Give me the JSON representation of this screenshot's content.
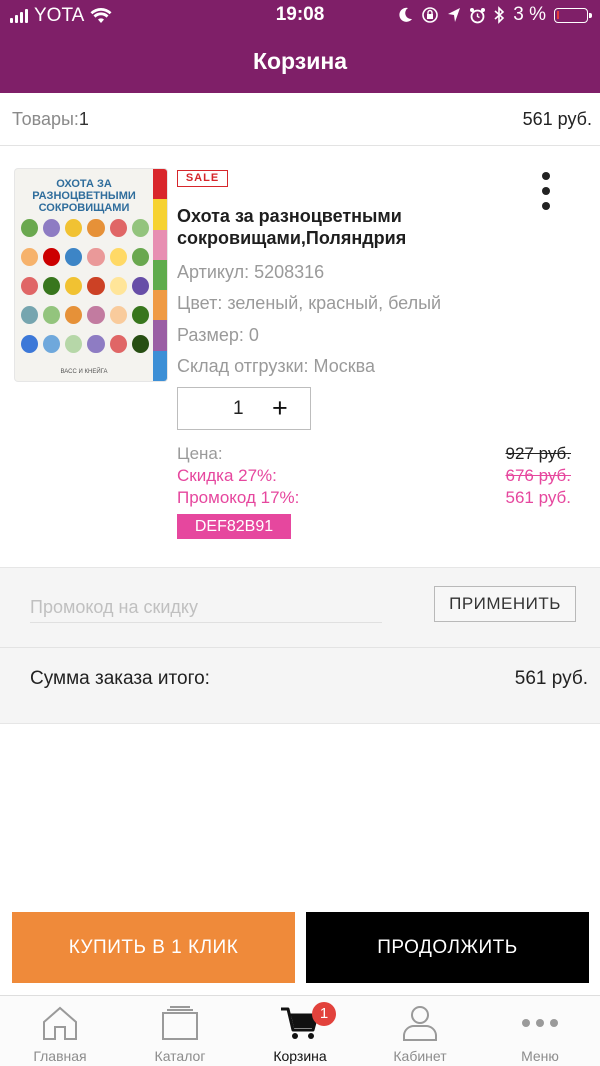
{
  "status_bar": {
    "carrier": "YOTA",
    "time": "19:08",
    "battery_text": "3 %",
    "battery_level": 0.03
  },
  "header": {
    "title": "Корзина"
  },
  "cart_summary": {
    "items_label": "Товары:",
    "items_count": "1",
    "total": "561 руб."
  },
  "product": {
    "badge": "SALE",
    "cover_title": "ОХОТА ЗА РАЗНОЦВЕТНЫМИ СОКРОВИЩАМИ",
    "cover_publisher": "ВАСС И КНЕЙГА",
    "name": "Охота за разноцветными сокровищами,Поляндрия",
    "article": "Артикул: 5208316",
    "color": "Цвет: зеленый, красный, белый",
    "size": "Размер: 0",
    "warehouse": "Склад отгрузки: Москва",
    "quantity": "1",
    "plus_symbol": "+",
    "price_label": "Цена:",
    "price_value": "927 руб.",
    "discount_label": "Скидка 27%:",
    "discount_value": "676 руб.",
    "promo_label": "Промокод 17%:",
    "promo_value": "561 руб.",
    "promo_code": "DEF82B91"
  },
  "promo": {
    "placeholder": "Промокод на скидку",
    "apply_label": "ПРИМЕНИТЬ"
  },
  "order_total": {
    "label": "Сумма заказа итого:",
    "value": "561 руб."
  },
  "actions": {
    "buy_one_click": "КУПИТЬ В 1 КЛИК",
    "continue": "ПРОДОЛЖИТЬ"
  },
  "tabbar": {
    "items": [
      {
        "label": "Главная",
        "icon": "home-icon"
      },
      {
        "label": "Каталог",
        "icon": "catalog-icon"
      },
      {
        "label": "Корзина",
        "icon": "cart-icon",
        "badge": "1",
        "active": true
      },
      {
        "label": "Кабинет",
        "icon": "user-icon"
      },
      {
        "label": "Меню",
        "icon": "more-icon"
      }
    ]
  },
  "colors": {
    "brand": "#7f1f68",
    "sale_red": "#d6262b",
    "discount_pink": "#e6479e",
    "buy_orange": "#ef8a3a",
    "badge_red": "#e2423c"
  }
}
